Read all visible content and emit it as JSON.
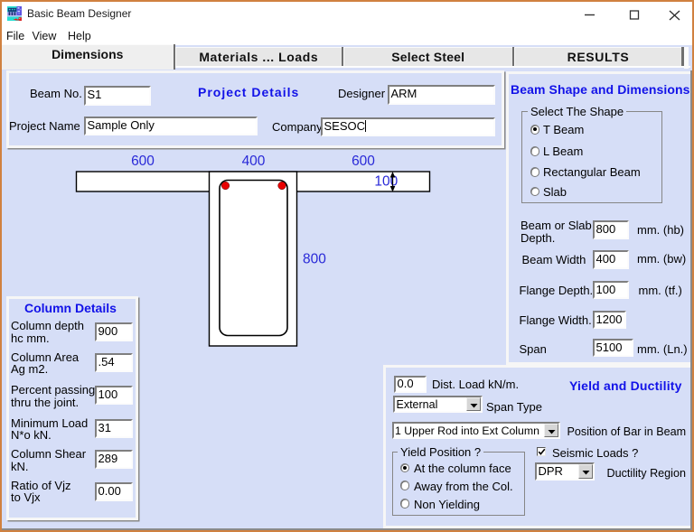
{
  "window": {
    "title": "Basic Beam Designer",
    "icon": "beam-app-icon"
  },
  "menu": {
    "items": [
      {
        "label": "File"
      },
      {
        "label": "View"
      },
      {
        "label": "Help"
      }
    ]
  },
  "tabs": [
    {
      "label": "Dimensions",
      "active": true
    },
    {
      "label": "Materials ... Loads",
      "active": false
    },
    {
      "label": "Select Steel",
      "active": false
    },
    {
      "label": "RESULTS",
      "active": false
    }
  ],
  "project": {
    "title": "Project Details",
    "beam_no_label": "Beam No.",
    "beam_no": "S1",
    "designer_label": "Designer",
    "designer": "ARM",
    "project_name_label": "Project Name",
    "project_name": "Sample Only",
    "company_label": "Company",
    "company": "SESOC"
  },
  "drawing": {
    "dim_left": "600",
    "dim_mid": "400",
    "dim_right": "600",
    "dim_flange": "100",
    "dim_depth": "800"
  },
  "column_details": {
    "title": "Column Details",
    "rows": [
      {
        "label1": "Column depth",
        "label2": "hc mm.",
        "value": "900"
      },
      {
        "label1": "Column Area",
        "label2": "Ag m2.",
        "value": ".54"
      },
      {
        "label1": "Percent passing",
        "label2": "thru the joint.",
        "value": "100"
      },
      {
        "label1": "Minimum Load",
        "label2": "N*o kN.",
        "value": "31"
      },
      {
        "label1": "Column Shear",
        "label2": "kN.",
        "value": "289"
      },
      {
        "label1": "Ratio of Vjz",
        "label2": "to Vjx",
        "value": "0.00"
      }
    ]
  },
  "beam_shape": {
    "title": "Beam Shape and Dimensions",
    "shape_group": {
      "title": "Select The Shape",
      "options": [
        {
          "label": "T Beam",
          "selected": true
        },
        {
          "label": "L Beam",
          "selected": false
        },
        {
          "label": "Rectangular Beam",
          "selected": false
        },
        {
          "label": "Slab",
          "selected": false
        }
      ]
    },
    "fields": [
      {
        "label1": "Beam or Slab",
        "label2": "Depth.",
        "value": "800",
        "unit": "mm. (hb)"
      },
      {
        "label1": "Beam Width",
        "label2": "",
        "value": "400",
        "unit": "mm. (bw)"
      },
      {
        "label1": "Flange Depth.",
        "label2": "",
        "value": "100",
        "unit": "mm. (tf.)"
      },
      {
        "label1": "Flange Width.",
        "label2": "",
        "value": "1200",
        "unit": ""
      },
      {
        "label1": "Span",
        "label2": "",
        "value": "5100",
        "unit": "mm. (Ln.)"
      }
    ]
  },
  "yield": {
    "title": "Yield and Ductility",
    "dist_load": "0.0",
    "dist_load_label": "Dist. Load kN/m.",
    "span_type": "External",
    "span_type_label": "Span Type",
    "bar_position": "1 Upper Rod into Ext Column",
    "bar_position_label": "Position of Bar in Beam",
    "yield_group": {
      "title": "Yield Position ?",
      "options": [
        {
          "label": "At the column face",
          "selected": true
        },
        {
          "label": "Away from the Col.",
          "selected": false
        },
        {
          "label": "Non Yielding",
          "selected": false
        }
      ]
    },
    "seismic_label": "Seismic Loads ?",
    "seismic_checked": true,
    "ductility": "DPR",
    "ductility_label": "Ductility Region"
  },
  "colors": {
    "window_border": "#d08140",
    "form_background": "#d6def7",
    "title_blue": "#1212e8",
    "dimension_blue": "#2929d8",
    "rebar_red": "#e80000"
  }
}
